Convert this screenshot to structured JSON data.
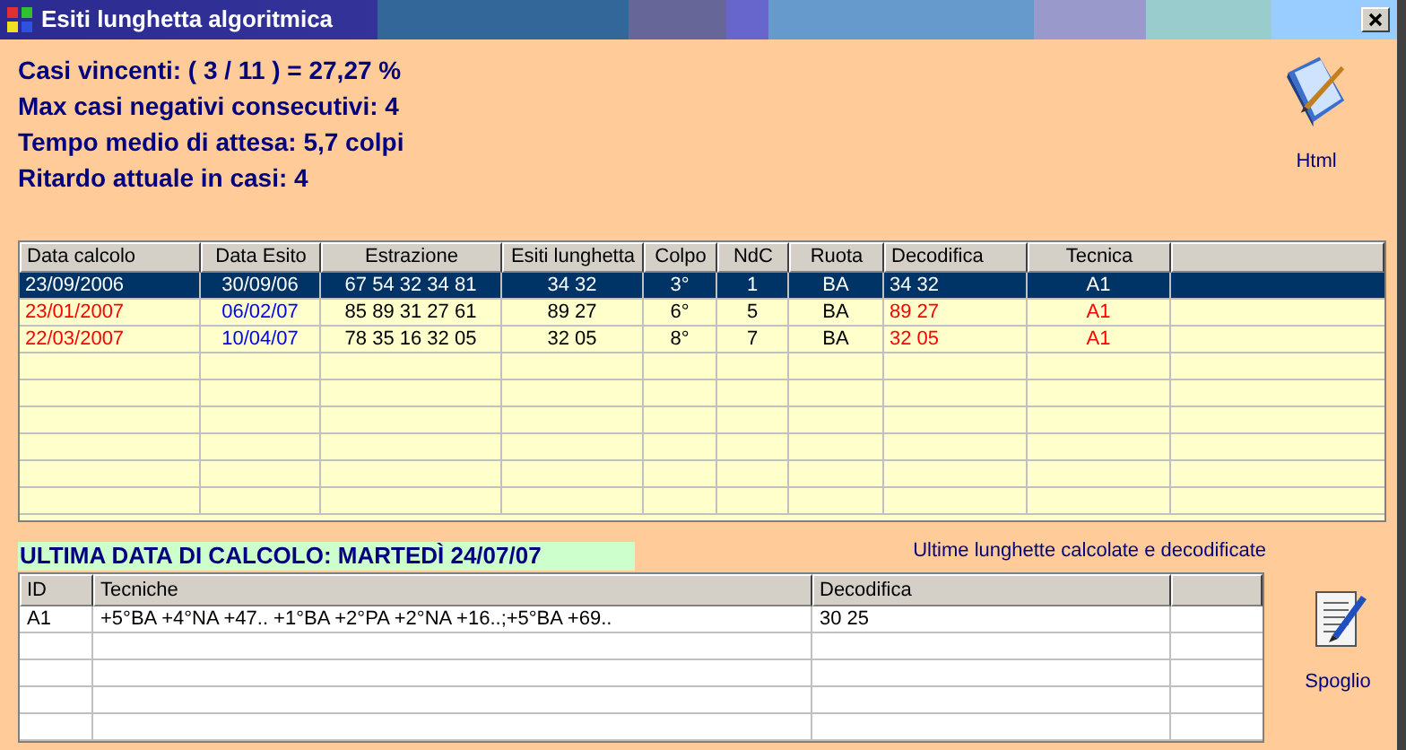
{
  "window": {
    "title": "Esiti lunghetta algoritmica"
  },
  "stats": [
    "Casi vincenti: ( 3 / 11 ) = 27,27 %",
    "Max casi negativi consecutivi: 4",
    "Tempo medio di attesa: 5,7 colpi",
    "Ritardo attuale in casi: 4"
  ],
  "html_button": {
    "label": "Html"
  },
  "results_table": {
    "columns": [
      {
        "label": "Data calcolo",
        "kind": "red"
      },
      {
        "label": "Data Esito",
        "kind": "blue"
      },
      {
        "label": "Estrazione",
        "kind": "plain"
      },
      {
        "label": "Esiti lunghetta",
        "kind": "plain"
      },
      {
        "label": "Colpo",
        "kind": "plain"
      },
      {
        "label": "NdC",
        "kind": "plain"
      },
      {
        "label": "Ruota",
        "kind": "plain"
      },
      {
        "label": "Decodifica",
        "kind": "red"
      },
      {
        "label": "Tecnica",
        "kind": "red"
      }
    ],
    "rows": [
      {
        "selected": true,
        "cells": [
          "23/09/2006",
          "30/09/06",
          "67 54 32 34 81",
          "34 32",
          "3°",
          "1",
          "BA",
          "34 32",
          "A1"
        ]
      },
      {
        "selected": false,
        "cells": [
          "23/01/2007",
          "06/02/07",
          "85 89 31 27 61",
          "89 27",
          "6°",
          "5",
          "BA",
          "89 27",
          "A1"
        ]
      },
      {
        "selected": false,
        "cells": [
          "22/03/2007",
          "10/04/07",
          "78 35 16 32 05",
          "32 05",
          "8°",
          "7",
          "BA",
          "32 05",
          "A1"
        ]
      }
    ]
  },
  "last_date": "ULTIMA DATA DI CALCOLO: MARTEDÌ 24/07/07",
  "last_caption": "Ultime lunghette calcolate e decodificate",
  "techniques_table": {
    "columns": [
      "ID",
      "Tecniche",
      "Decodifica"
    ],
    "rows": [
      [
        "A1",
        "+5°BA +4°NA +47.. +1°BA +2°PA +2°NA +16..;+5°BA +69..",
        "30 25"
      ]
    ]
  },
  "spoglio_button": {
    "label": "Spoglio"
  }
}
